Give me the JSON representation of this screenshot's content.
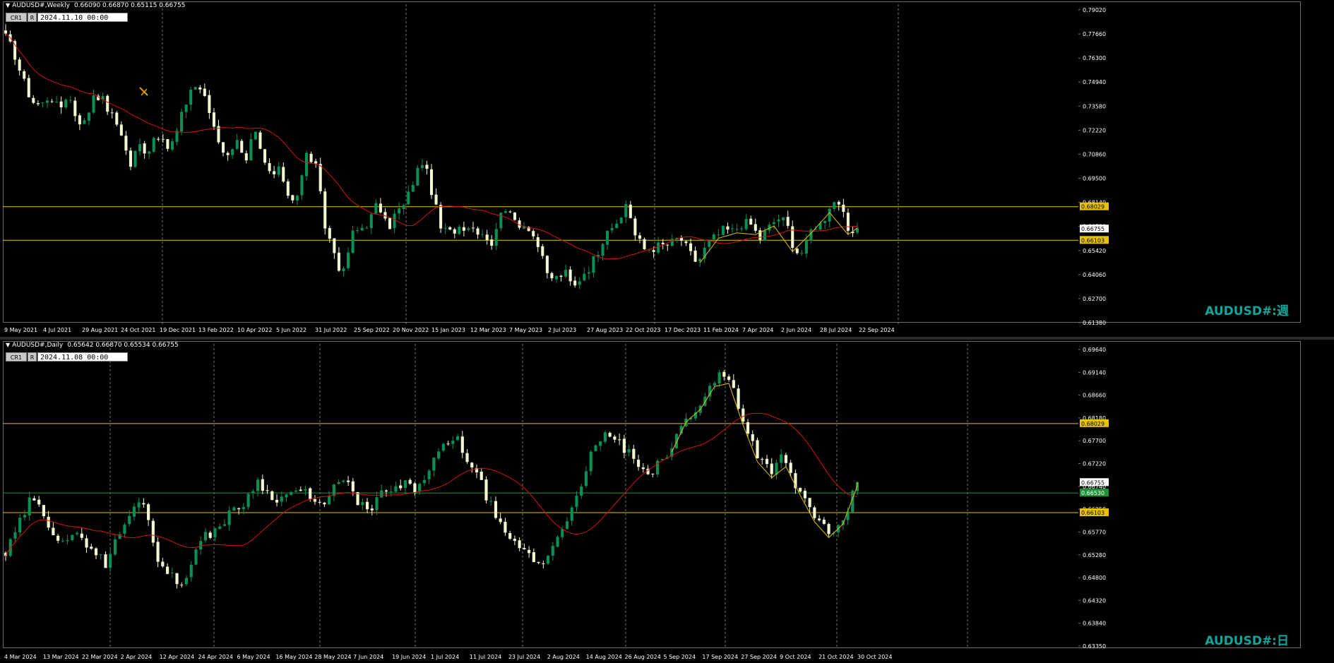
{
  "colors": {
    "background": "#000000",
    "grid": "#b4b4b4",
    "axis": "#6e6e6e",
    "text": "#ffffff",
    "bull": "#0a8f55",
    "bear": "#f4f7d2",
    "ma": "#d21414",
    "level": "#e6c200",
    "zigzag": "#e6c200",
    "current_line": "#1f8f3a",
    "watermark": "#12a59a"
  },
  "icons": {
    "collapse": "triangle-down-icon",
    "drawing": "pencil-object-icon"
  },
  "weekly": {
    "header_symbol": "AUDUSD#,Weekly",
    "header_values": "0.66090 0.66870 0.65115 0.66755",
    "btn_cr": "CR1",
    "btn_r": "R",
    "date_value": "2024.11.10 00:00",
    "watermark": "AUDUSD#:週"
  },
  "daily": {
    "header_symbol": "AUDUSD#,Daily",
    "header_values": "0.65642 0.66870 0.65534 0.66755",
    "btn_cr": "CR1",
    "btn_r": "R",
    "date_value": "2024.11.08 00:00",
    "watermark": "AUDUSD#:日"
  },
  "chart_data": [
    {
      "type": "candlestick",
      "title": "AUDUSD#,Weekly",
      "ylim": [
        0.6138,
        0.7955
      ],
      "y_ticks": [
        "0.79020",
        "0.77660",
        "0.76300",
        "0.74940",
        "0.73580",
        "0.72220",
        "0.70860",
        "0.69500",
        "0.68140",
        "0.66780",
        "0.65420",
        "0.64060",
        "0.62700",
        "0.61380"
      ],
      "x_ticks": [
        "9 May 2021",
        "4 Jul 2021",
        "29 Aug 2021",
        "24 Oct 2021",
        "19 Dec 2021",
        "13 Feb 2022",
        "10 Apr 2022",
        "5 Jun 2022",
        "31 Jul 2022",
        "25 Sep 2022",
        "20 Nov 2022",
        "15 Jan 2023",
        "12 Mar 2023",
        "7 May 2023",
        "2 Jul 2023",
        "27 Aug 2023",
        "22 Oct 2023",
        "17 Dec 2023",
        "11 Feb 2024",
        "7 Apr 2024",
        "2 Jun 2024",
        "28 Jul 2024",
        "22 Sep 2024"
      ],
      "grid": "dashed vertical",
      "horizontal_levels": [
        {
          "value": 0.68029,
          "label": "0.68029"
        },
        {
          "value": 0.66103,
          "label": "0.66103"
        }
      ],
      "current_price": {
        "value": 0.66755,
        "label": "0.66755"
      },
      "close_anchors": [
        0.777,
        0.768,
        0.752,
        0.741,
        0.738,
        0.745,
        0.735,
        0.746,
        0.731,
        0.728,
        0.747,
        0.741,
        0.732,
        0.724,
        0.703,
        0.716,
        0.712,
        0.724,
        0.713,
        0.718,
        0.735,
        0.75,
        0.748,
        0.734,
        0.719,
        0.708,
        0.722,
        0.702,
        0.724,
        0.706,
        0.698,
        0.701,
        0.685,
        0.688,
        0.712,
        0.702,
        0.669,
        0.655,
        0.64,
        0.664,
        0.668,
        0.672,
        0.683,
        0.667,
        0.677,
        0.681,
        0.696,
        0.707,
        0.69,
        0.668,
        0.665,
        0.669,
        0.67,
        0.668,
        0.665,
        0.658,
        0.684,
        0.673,
        0.671,
        0.669,
        0.658,
        0.641,
        0.639,
        0.643,
        0.633,
        0.642,
        0.647,
        0.658,
        0.671,
        0.667,
        0.684,
        0.663,
        0.656,
        0.657,
        0.658,
        0.659,
        0.663,
        0.654,
        0.648,
        0.658,
        0.663,
        0.667,
        0.666,
        0.671,
        0.67,
        0.662,
        0.668,
        0.674,
        0.671,
        0.655,
        0.654,
        0.67,
        0.67,
        0.683,
        0.683,
        0.663,
        0.668
      ],
      "moving_average": "red 20-period",
      "zigzag": "yellow, late 2023 onward"
    },
    {
      "type": "candlestick",
      "title": "AUDUSD#,Daily",
      "ylim": [
        0.6322,
        0.6972
      ],
      "y_ticks": [
        "0.69640",
        "0.69140",
        "0.68660",
        "0.68180",
        "0.67700",
        "0.67220",
        "0.66740",
        "0.66250",
        "0.65770",
        "0.65280",
        "0.64800",
        "0.64320",
        "0.63840",
        "0.63350"
      ],
      "x_ticks": [
        "4 Mar 2024",
        "13 Mar 2024",
        "22 Mar 2024",
        "2 Apr 2024",
        "12 Apr 2024",
        "24 Apr 2024",
        "6 May 2024",
        "16 May 2024",
        "28 May 2024",
        "7 Jun 2024",
        "19 Jun 2024",
        "1 Jul 2024",
        "11 Jul 2024",
        "23 Jul 2024",
        "2 Aug 2024",
        "14 Aug 2024",
        "26 Aug 2024",
        "5 Sep 2024",
        "17 Sep 2024",
        "27 Sep 2024",
        "9 Oct 2024",
        "21 Oct 2024",
        "30 Oct 2024"
      ],
      "grid": "dashed vertical",
      "horizontal_levels": [
        {
          "value": 0.68029,
          "label": "0.68029"
        },
        {
          "value": 0.66103,
          "label": "0.66103"
        }
      ],
      "current_price": {
        "value": 0.66755,
        "label": "0.66755"
      },
      "ask_price": {
        "value": 0.6653,
        "label": "0.66530"
      },
      "close_anchors": [
        0.652,
        0.658,
        0.664,
        0.661,
        0.656,
        0.655,
        0.656,
        0.653,
        0.65,
        0.656,
        0.661,
        0.664,
        0.652,
        0.648,
        0.645,
        0.652,
        0.656,
        0.658,
        0.661,
        0.663,
        0.668,
        0.665,
        0.664,
        0.666,
        0.665,
        0.662,
        0.666,
        0.668,
        0.664,
        0.661,
        0.665,
        0.666,
        0.667,
        0.666,
        0.672,
        0.675,
        0.677,
        0.672,
        0.667,
        0.661,
        0.655,
        0.654,
        0.651,
        0.65,
        0.656,
        0.661,
        0.666,
        0.676,
        0.678,
        0.676,
        0.673,
        0.669,
        0.671,
        0.674,
        0.68,
        0.683,
        0.687,
        0.691,
        0.689,
        0.68,
        0.674,
        0.67,
        0.673,
        0.667,
        0.663,
        0.659,
        0.655,
        0.66,
        0.6676
      ],
      "moving_average": "red 20-period",
      "zigzag": "yellow, Sep 2024 onward"
    }
  ]
}
